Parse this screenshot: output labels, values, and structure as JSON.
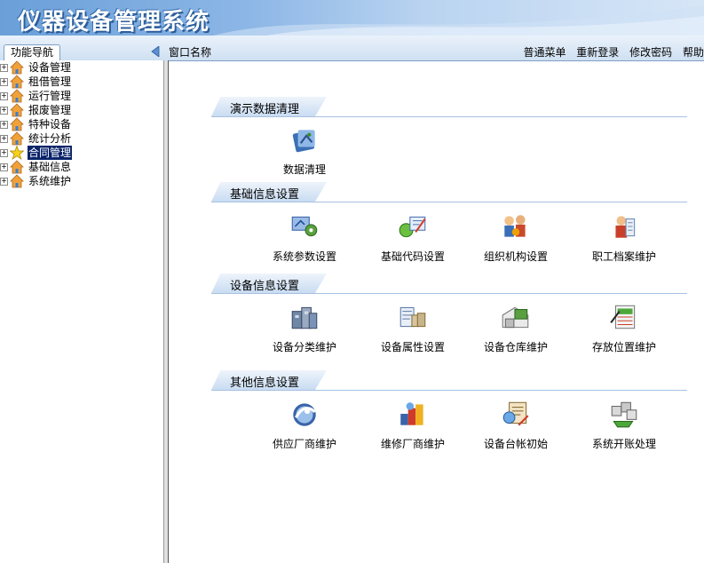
{
  "app": {
    "title": "仪器设备管理系统"
  },
  "toolbar": {
    "nav_tab": "功能导航",
    "window_name": "窗口名称",
    "links": [
      "普通菜单",
      "重新登录",
      "修改密码",
      "帮助"
    ]
  },
  "sidebar": {
    "items": [
      {
        "label": "设备管理",
        "icon": "house-icon",
        "selected": false
      },
      {
        "label": "租借管理",
        "icon": "house-icon",
        "selected": false
      },
      {
        "label": "运行管理",
        "icon": "house-icon",
        "selected": false
      },
      {
        "label": "报废管理",
        "icon": "house-icon",
        "selected": false
      },
      {
        "label": "特种设备",
        "icon": "house-icon",
        "selected": false
      },
      {
        "label": "统计分析",
        "icon": "house-icon",
        "selected": false
      },
      {
        "label": "合同管理",
        "icon": "star-icon",
        "selected": true
      },
      {
        "label": "基础信息",
        "icon": "house-icon",
        "selected": false
      },
      {
        "label": "系统维护",
        "icon": "house-icon",
        "selected": false
      }
    ]
  },
  "sections": [
    {
      "title": "演示数据清理",
      "items": [
        {
          "label": "数据清理",
          "icon": "data-cleanup-icon"
        }
      ]
    },
    {
      "title": "基础信息设置",
      "items": [
        {
          "label": "系统参数设置",
          "icon": "system-params-icon"
        },
        {
          "label": "基础代码设置",
          "icon": "base-code-icon"
        },
        {
          "label": "组织机构设置",
          "icon": "organization-icon"
        },
        {
          "label": "职工档案维护",
          "icon": "staff-records-icon"
        }
      ]
    },
    {
      "title": "设备信息设置",
      "items": [
        {
          "label": "设备分类维护",
          "icon": "equipment-category-icon"
        },
        {
          "label": "设备属性设置",
          "icon": "equipment-attributes-icon"
        },
        {
          "label": "设备仓库维护",
          "icon": "warehouse-icon"
        },
        {
          "label": "存放位置维护",
          "icon": "storage-location-icon"
        }
      ]
    },
    {
      "title": "其他信息设置",
      "items": [
        {
          "label": "供应厂商维护",
          "icon": "supplier-icon"
        },
        {
          "label": "维修厂商维护",
          "icon": "repair-vendor-icon"
        },
        {
          "label": "设备台帐初始",
          "icon": "ledger-init-icon"
        },
        {
          "label": "系统开账处理",
          "icon": "account-opening-icon"
        }
      ]
    }
  ]
}
